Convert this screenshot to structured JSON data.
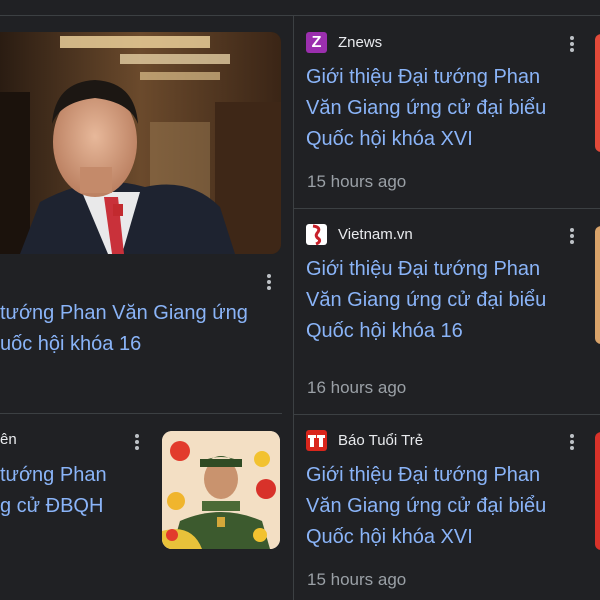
{
  "left": {
    "hero": {
      "title_lines": [
        "tướng Phan Văn Giang ứng",
        "uốc hội khóa 16"
      ]
    },
    "story3": {
      "source": "ên",
      "title_lines": [
        "tướng Phan",
        "g cử ĐBQH"
      ]
    }
  },
  "right": {
    "cards": [
      {
        "source": "Znews",
        "title_lines": [
          "Giới thiệu Đại tướng Phan",
          "Văn Giang ứng cử đại biểu",
          "Quốc hội khóa XVI"
        ],
        "time": "15 hours ago"
      },
      {
        "source": "Vietnam.vn",
        "title_lines": [
          "Giới thiệu Đại tướng Phan",
          "Văn Giang ứng cử đại biểu",
          "Quốc hội khóa 16"
        ],
        "time": "16 hours ago"
      },
      {
        "source": "Báo Tuổi Trẻ",
        "title_lines": [
          "Giới thiệu Đại tướng Phan",
          "Văn Giang ứng cử đại biểu",
          "Quốc hội khóa XVI"
        ],
        "time": "15 hours ago"
      }
    ]
  },
  "colors": {
    "background": "#202124",
    "link": "#8ab4f8",
    "text": "#e8eaed",
    "muted": "#9aa0a6",
    "divider": "#3c4043",
    "znews_brand": "#9b2fae",
    "tuoitre_brand": "#d9261c"
  },
  "icons": [
    "more-vert-icon",
    "znews-logo",
    "vietnam-vn-logo",
    "tuoi-tre-logo"
  ]
}
